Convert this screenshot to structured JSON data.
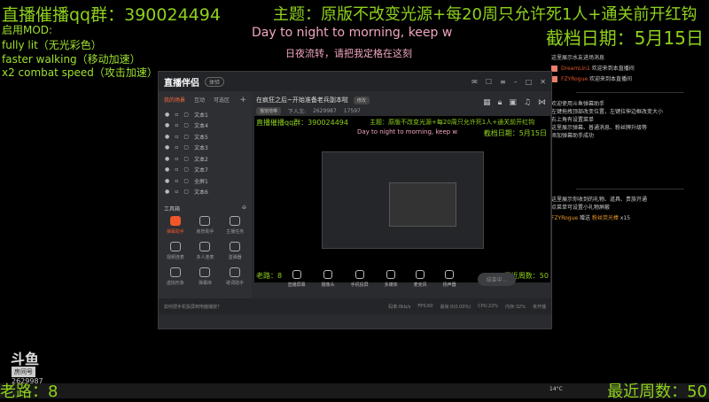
{
  "overlay": {
    "qq_group": "直播催播qq群：390024494",
    "topic": "主题：原版不改变光源+每20周只允许死1人+通关前开红钩",
    "save_date": "截档日期：5月15日",
    "mod_title": "启用MOD:",
    "mods": [
      "fully lit（无光彩色）",
      "faster walking（移动加速）",
      "x2 combat speed（攻击加速）"
    ],
    "subtitle_en": "Day to night to morning, keep w",
    "subtitle_cn": "日夜流转，请把我定格在这刻",
    "old_road": "老路：8",
    "recent_weeks": "最近周数：50",
    "room_label": "房间号",
    "room_number": "2629987",
    "logo": "斗鱼"
  },
  "side": {
    "hint1": "这里展示水友进场消息",
    "msgs": [
      {
        "user": "DreamLin1",
        "text": "欢迎来到本直播间"
      },
      {
        "user": "FZYRogue",
        "text": "欢迎来到本直播间"
      }
    ],
    "help": [
      "欢迎使用斗鱼弹幕助手",
      "左键拖拽顶部改变位置，左键拉伸边框改变大小",
      "右上角有设置菜单",
      "这里展示弹幕、普通消息、粉丝牌升级等",
      "添加弹幕助手成功"
    ],
    "gift_hint": [
      "这里展示你收到的礼物、道具、贵族开通",
      "点菜单可设置小礼物屏蔽"
    ],
    "gift": {
      "user": "FZYRogue",
      "action": "赠送",
      "item": "粉丝荧光棒",
      "count": "x15"
    }
  },
  "app": {
    "name": "直播伴侣",
    "version": "体验",
    "tabs": [
      "我的场景",
      "互动",
      "可选区"
    ],
    "scenes": [
      "文本1",
      "文本4",
      "文本5",
      "文本3",
      "文本2",
      "文本7",
      "全屏1",
      "文本6"
    ],
    "toolbox": "工具箱",
    "tools": [
      "弹幕助手",
      "房管助手",
      "主播任务",
      "视频连麦",
      "多人连麦",
      "鉴弹器",
      "虚拟形象",
      "弹幕库",
      "歌词助手"
    ],
    "stream_title": "在疯狂之后~开始准备老兵副本啦",
    "edit": "修改",
    "category": "猫馆地带",
    "viewers_label": "下人次:",
    "viewers": "2629987",
    "hot": "17597",
    "controls": [
      "直播屏幕",
      "摄像头",
      "手机投屏",
      "多媒体",
      "麦克风",
      "扬声器"
    ],
    "go_live": "结束中...",
    "tip": "如何把手机投屏到电脑播放？",
    "stats": [
      "码率:0kb/s",
      "FPS:60",
      "丢帧:0(0.00%)",
      "CPU:22%",
      "内存:32%",
      "未开播"
    ]
  },
  "taskbar": {
    "weather": "14°C"
  }
}
